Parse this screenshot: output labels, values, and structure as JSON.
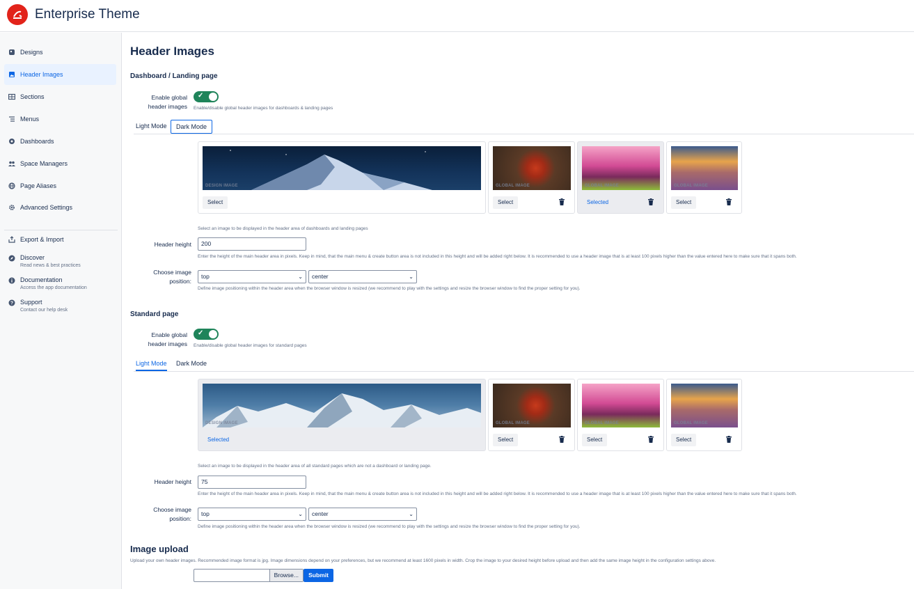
{
  "app": {
    "title": "Enterprise Theme"
  },
  "sidebar": {
    "items": [
      {
        "label": "Designs",
        "icon": "palette-icon"
      },
      {
        "label": "Header Images",
        "icon": "image-icon",
        "active": true
      },
      {
        "label": "Sections",
        "icon": "sections-icon"
      },
      {
        "label": "Menus",
        "icon": "menu-icon"
      },
      {
        "label": "Dashboards",
        "icon": "dashboard-icon"
      },
      {
        "label": "Space Managers",
        "icon": "people-icon"
      },
      {
        "label": "Page Aliases",
        "icon": "globe-icon"
      },
      {
        "label": "Advanced Settings",
        "icon": "gear-icon"
      }
    ],
    "secondary": [
      {
        "label": "Export & Import",
        "icon": "export-icon"
      },
      {
        "label": "Discover",
        "sub": "Read news & best practices",
        "icon": "compass-icon"
      },
      {
        "label": "Documentation",
        "sub": "Access the app documentation",
        "icon": "book-icon"
      },
      {
        "label": "Support",
        "sub": "Contact our help desk",
        "icon": "question-icon"
      }
    ]
  },
  "main": {
    "title": "Header Images",
    "dashboard": {
      "heading": "Dashboard / Landing page",
      "enable_label_1": "Enable global",
      "enable_label_2": "header images",
      "enable_help": "Enable/disable global header images for dashboards & landing pages",
      "tabs": [
        "Light Mode",
        "Dark Mode"
      ],
      "active_tab": "Dark Mode",
      "images": [
        {
          "tag": "DESIGN IMAGE",
          "button": "Select",
          "selected": false,
          "deletable": false
        },
        {
          "tag": "GLOBAL IMAGE",
          "button": "Select",
          "selected": false,
          "deletable": true
        },
        {
          "tag": "GLOBAL IMAGE",
          "button": "Selected",
          "selected": true,
          "deletable": true
        },
        {
          "tag": "GLOBAL IMAGE",
          "button": "Select",
          "selected": false,
          "deletable": true
        }
      ],
      "image_help": "Select an image to be displayed in the header area of dashboards and landing pages",
      "height_label": "Header height",
      "height_value": "200",
      "height_help": "Enter the height of the main header area in pixels. Keep in mind, that the main menu & create button area is not included in this height and will be added right below. It is recommended to use a header image that is at least 100 pixels higher than the value entered here to make sure that it spans both.",
      "position_label_1": "Choose image",
      "position_label_2": "position:",
      "position_v": "top",
      "position_h": "center",
      "position_help": "Define image positioning within the header area when the browser window is resized (we recommend to play with the settings and resize the browser window to find the proper setting for you)."
    },
    "standard": {
      "heading": "Standard page",
      "enable_label_1": "Enable global",
      "enable_label_2": "header images",
      "enable_help": "Enable/disable global header images for standard pages",
      "tabs": [
        "Light Mode",
        "Dark Mode"
      ],
      "active_tab": "Light Mode",
      "images": [
        {
          "tag": "DESIGN IMAGE",
          "button": "Selected",
          "selected": true,
          "deletable": false
        },
        {
          "tag": "GLOBAL IMAGE",
          "button": "Select",
          "selected": false,
          "deletable": true
        },
        {
          "tag": "GLOBAL IMAGE",
          "button": "Select",
          "selected": false,
          "deletable": true
        },
        {
          "tag": "GLOBAL IMAGE",
          "button": "Select",
          "selected": false,
          "deletable": true
        }
      ],
      "image_help": "Select an image to be displayed in the header area of all standard pages which are not a dashboard or landing page.",
      "height_label": "Header height",
      "height_value": "75",
      "height_help": "Enter the height of the main header area in pixels. Keep in mind, that the main menu & create button area is not included in this height and will be added right below. It is recommended to use a header image that is at least 100 pixels higher than the value entered here to make sure that it spans both.",
      "position_label_1": "Choose image",
      "position_label_2": "position:",
      "position_v": "top",
      "position_h": "center",
      "position_help": "Define image positioning within the header area when the browser window is resized (we recommend to play with the settings and resize the browser window to find the proper setting for you)."
    },
    "upload": {
      "heading": "Image upload",
      "help": "Upload your own header images. Recommended image format is jpg. Image dimensions depend on your preferences, but we recommend at least 1600 pixels in width. Crop the image to your desired height before upload and then add the same image height in the configuration settings above.",
      "browse": "Browse...",
      "submit": "Submit"
    }
  },
  "colors": {
    "accent": "#0c66e4",
    "toggle_on": "#1f845a",
    "brand": "#e2231a"
  }
}
